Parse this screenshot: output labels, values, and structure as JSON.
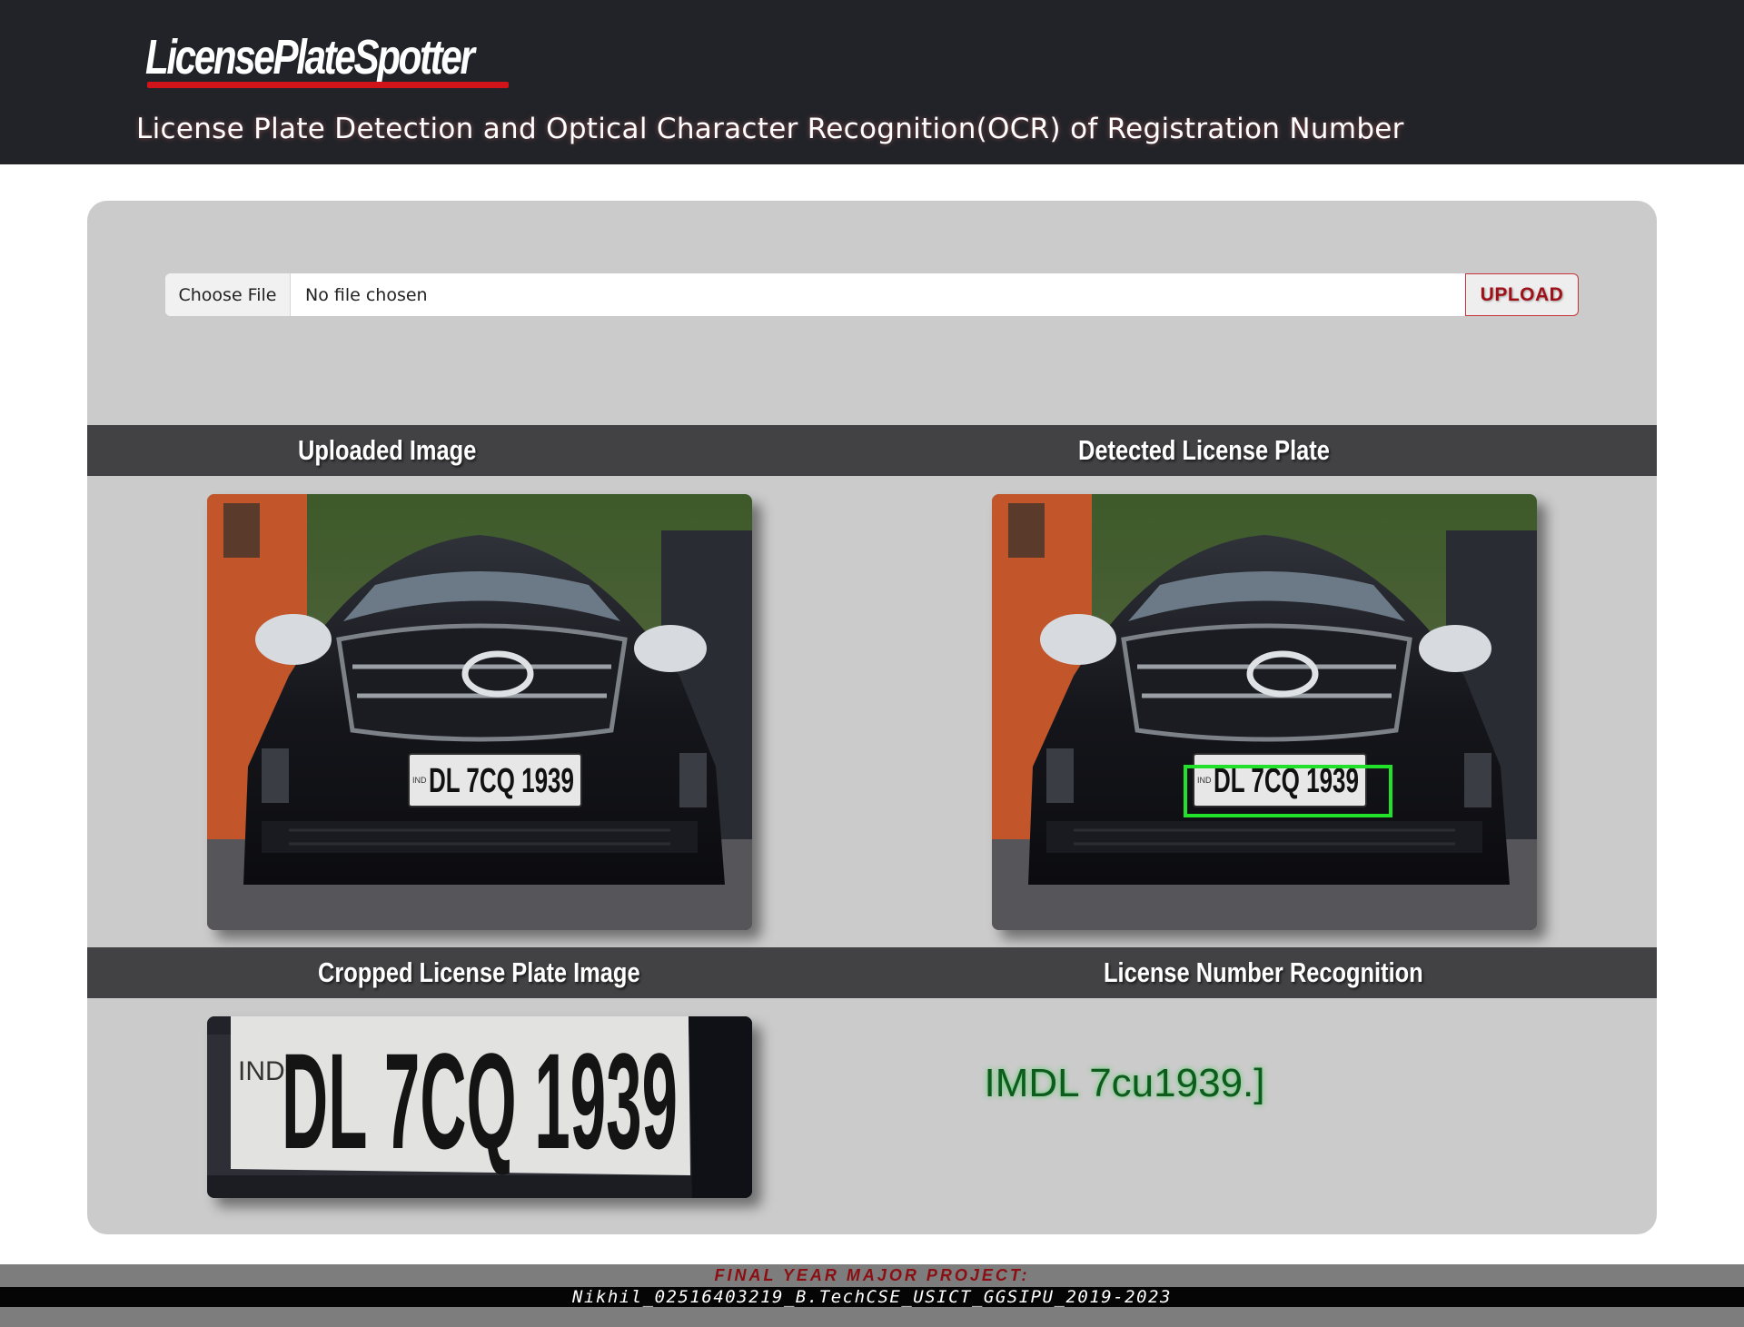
{
  "header": {
    "logo_text": "LicensePlateSpotter",
    "subtitle": "License Plate Detection and Optical Character Recognition(OCR) of Registration Number"
  },
  "upload": {
    "choose_label": "Choose File",
    "file_status": "No file chosen",
    "upload_label": "UPLOAD"
  },
  "sections": {
    "uploaded_image": "Uploaded Image",
    "detected_plate": "Detected License Plate",
    "cropped_plate": "Cropped License Plate Image",
    "recognition": "License Number Recognition"
  },
  "images": {
    "plate_text": "DL 7CQ 1939",
    "plate_prefix": "IND"
  },
  "ocr_result": "IMDL 7cu1939.]",
  "footer": {
    "label": "FINAL YEAR MAJOR PROJECT:",
    "credit": "Nikhil_02516403219_B.TechCSE_USICT_GGSIPU_2019-2023"
  },
  "colors": {
    "header_bg": "#212328",
    "panel_bg": "#cbcbcb",
    "section_bar": "#424244",
    "accent_red": "#d0141a",
    "detection_box": "#22e12a",
    "ocr_text": "#0e5b1e"
  }
}
